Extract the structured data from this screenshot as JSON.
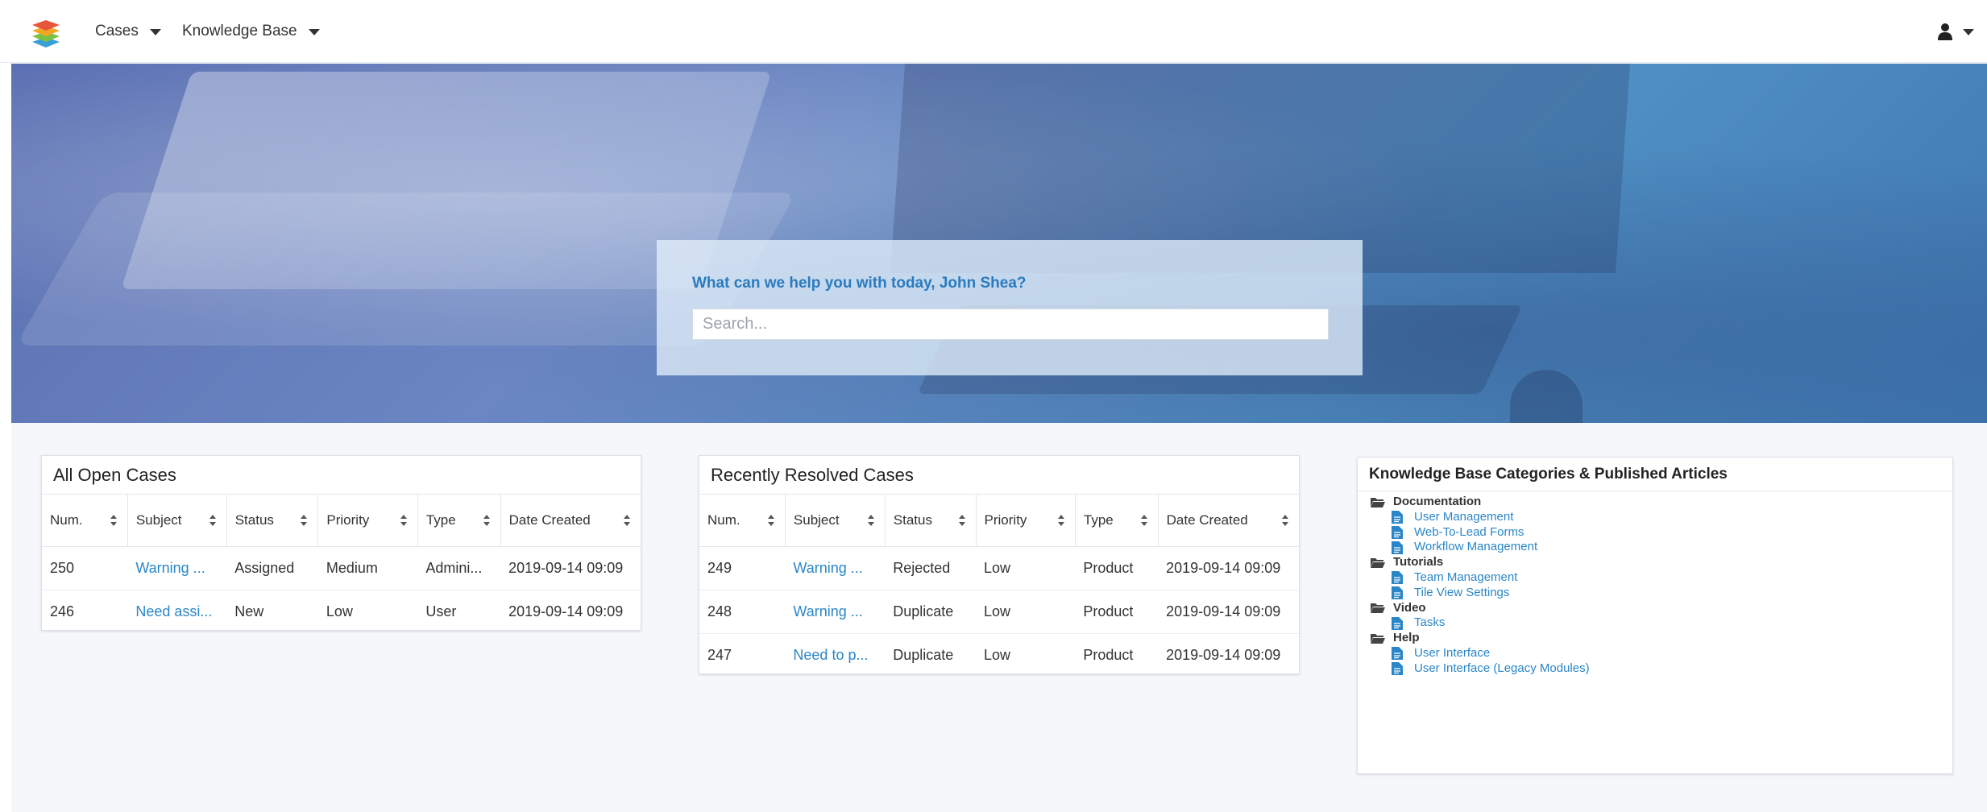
{
  "nav": {
    "menu_items": [
      {
        "label": "Cases"
      },
      {
        "label": "Knowledge Base"
      }
    ]
  },
  "hero": {
    "greeting": "What can we help you with today, John Shea?",
    "search_placeholder": "Search..."
  },
  "open_cases": {
    "title": "All Open Cases",
    "columns": [
      "Num.",
      "Subject",
      "Status",
      "Priority",
      "Type",
      "Date Created"
    ],
    "rows": [
      {
        "num": "250",
        "subject": "Warning ...",
        "status": "Assigned",
        "priority": "Medium",
        "type": "Admini...",
        "date": "2019-09-14 09:09"
      },
      {
        "num": "246",
        "subject": "Need assi...",
        "status": "New",
        "priority": "Low",
        "type": "User",
        "date": "2019-09-14 09:09"
      }
    ]
  },
  "resolved_cases": {
    "title": "Recently Resolved Cases",
    "columns": [
      "Num.",
      "Subject",
      "Status",
      "Priority",
      "Type",
      "Date Created"
    ],
    "rows": [
      {
        "num": "249",
        "subject": "Warning ...",
        "status": "Rejected",
        "priority": "Low",
        "type": "Product",
        "date": "2019-09-14 09:09"
      },
      {
        "num": "248",
        "subject": "Warning ...",
        "status": "Duplicate",
        "priority": "Low",
        "type": "Product",
        "date": "2019-09-14 09:09"
      },
      {
        "num": "247",
        "subject": "Need to p...",
        "status": "Duplicate",
        "priority": "Low",
        "type": "Product",
        "date": "2019-09-14 09:09"
      }
    ]
  },
  "knowledge_base": {
    "title": "Knowledge Base Categories & Published Articles",
    "categories": [
      {
        "name": "Documentation",
        "articles": [
          "User Management",
          "Web-To-Lead Forms",
          "Workflow Management"
        ]
      },
      {
        "name": "Tutorials",
        "articles": [
          "Team Management",
          "Tile View Settings"
        ]
      },
      {
        "name": "Video",
        "articles": [
          "Tasks"
        ]
      },
      {
        "name": "Help",
        "articles": [
          "User Interface",
          "User Interface (Legacy Modules)"
        ]
      }
    ]
  },
  "colors": {
    "accent": "#2a86c8",
    "greeting": "#2a7bbf",
    "hero_tint": "#5a7dbd"
  },
  "icons": {
    "logo": "stacked-layers-logo",
    "user": "user-icon",
    "sort": "sort-icon",
    "folder": "folder-open-icon",
    "article": "document-icon"
  }
}
